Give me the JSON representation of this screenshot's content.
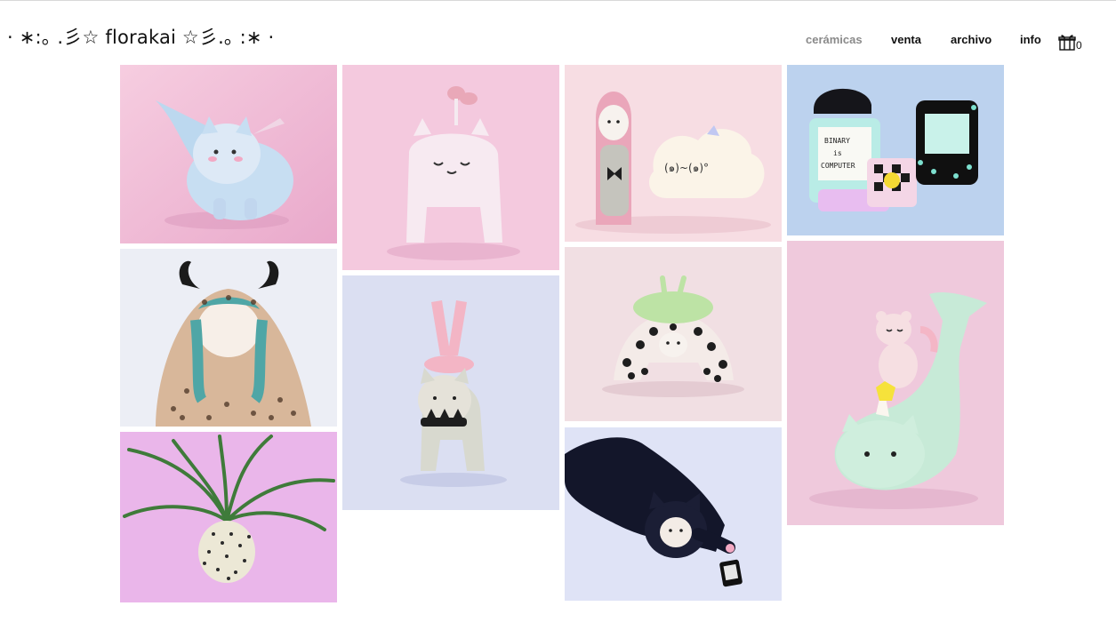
{
  "site": {
    "logo": "· ∗:｡ .彡☆ florakai ☆彡.｡ :∗ ·"
  },
  "nav": {
    "items": [
      {
        "label": "cerámicas",
        "active": true
      },
      {
        "label": "venta",
        "active": false
      },
      {
        "label": "archivo",
        "active": false
      },
      {
        "label": "info",
        "active": false
      }
    ],
    "cart_count": "0",
    "cart_icon": "gift-icon"
  },
  "gallery": {
    "items": [
      {
        "subject": "pastel blue cat mermaid figurine",
        "bg": "#f2c6dc"
      },
      {
        "subject": "white creature with mushrooms",
        "bg": "#f4c9de"
      },
      {
        "subject": "bunny hood figure and cloud",
        "bg": "#f7dde3"
      },
      {
        "subject": "computer figurines",
        "bg": "#bcd2ee",
        "text": "BINARY is COMPUTER"
      },
      {
        "subject": "horned leopard-cloak doll",
        "bg": "#eceef5"
      },
      {
        "subject": "spiked collar cat with legs",
        "bg": "#dbdff2"
      },
      {
        "subject": "leopard figure with green lid",
        "bg": "#f1dfe3"
      },
      {
        "subject": "unicorn whale cat with bear",
        "bg": "#efc9dc"
      },
      {
        "subject": "leopard spotted planter",
        "bg": "#eab6ea"
      },
      {
        "subject": "black cat lying with phone",
        "bg": "#dfe3f6"
      }
    ]
  }
}
